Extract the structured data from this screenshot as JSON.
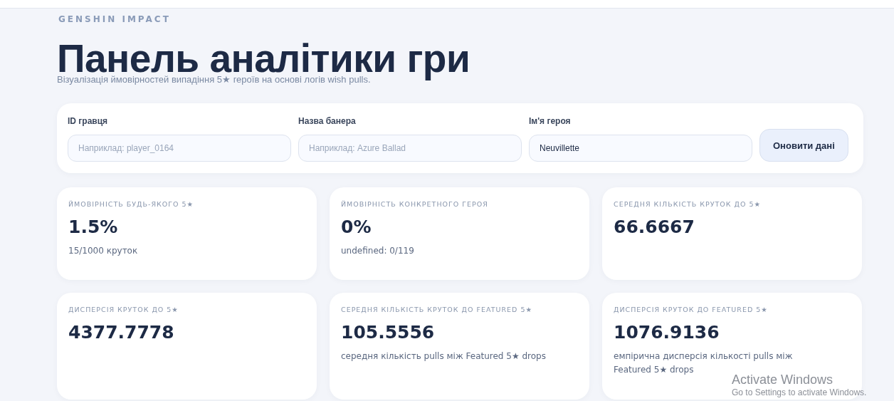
{
  "brand": "GENSHIN IMPACT",
  "title": "Панель аналітики гри",
  "subtitle": "Візуалізація ймовірностей випадіння 5★ героїв на основі логів wish pulls.",
  "filters": [
    {
      "label": "ID гравця",
      "placeholder": "Наприклад: player_0164"
    },
    {
      "label": "Назва банера",
      "placeholder": "Наприклад: Azure Ballad"
    },
    {
      "label": "Ім'я героя",
      "value": "Neuvillette"
    }
  ],
  "refresh_button": "Оновити дані",
  "stats": [
    {
      "label": "ЙМОВІРНІСТЬ БУДЬ-ЯКОГО 5★",
      "value": "1.5%",
      "note": "15/1000 круток"
    },
    {
      "label": "ЙМОВІРНІСТЬ КОНКРЕТНОГО ГЕРОЯ",
      "value": "0%",
      "note": "undefined: 0/119"
    },
    {
      "label": "СЕРЕДНЯ КІЛЬКІСТЬ КРУТОК ДО 5★",
      "value": "66.6667"
    },
    {
      "label": "ДИСПЕРСІЯ КРУТОК ДО 5★",
      "value": "4377.7778"
    },
    {
      "label": "СЕРЕДНЯ КІЛЬКІСТЬ КРУТОК ДО FEATURED 5★",
      "value": "105.5556",
      "note": "середня кількість pulls між Featured 5★ drops"
    },
    {
      "label": "ДИСПЕРСІЯ КРУТОК ДО FEATURED 5★",
      "value": "1076.9136",
      "note": "емпірична дисперсія кількості pulls між Featured 5★ drops"
    }
  ],
  "os_overlay": {
    "title": "Activate Windows",
    "hint": "Go to Settings to activate Windows."
  }
}
